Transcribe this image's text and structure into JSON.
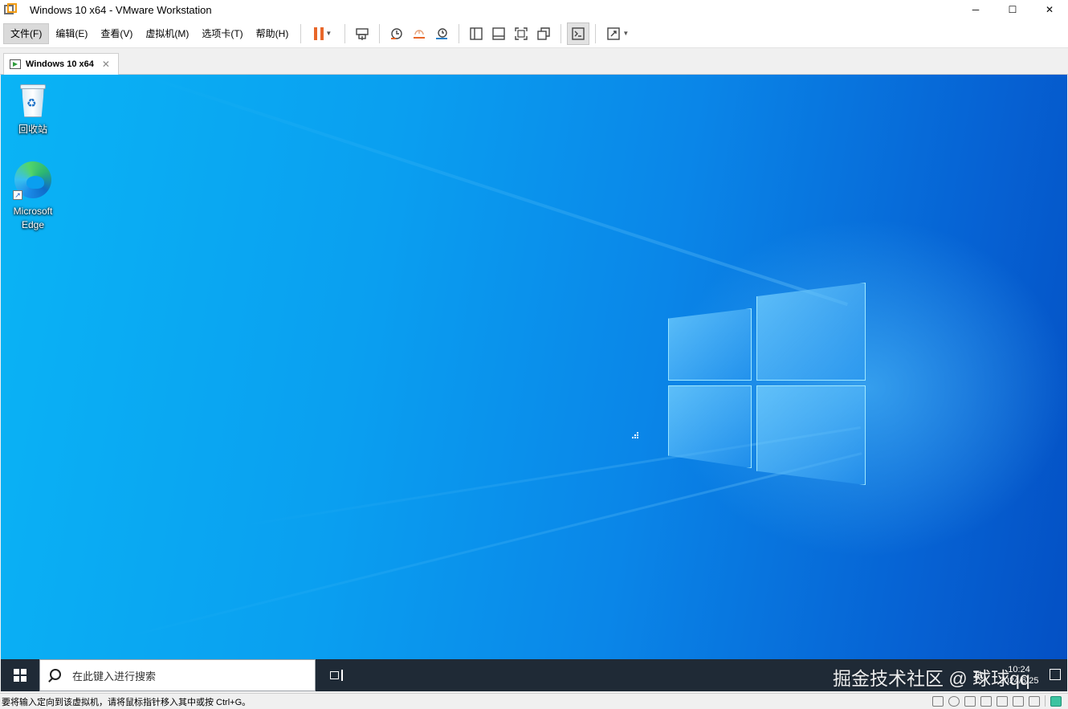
{
  "window": {
    "title": "Windows 10 x64 - VMware Workstation",
    "minimize": "─",
    "maximize": "☐",
    "close": "✕"
  },
  "menu": {
    "file": "文件(F)",
    "edit": "编辑(E)",
    "view": "查看(V)",
    "vm": "虚拟机(M)",
    "tabs": "选项卡(T)",
    "help": "帮助(H)"
  },
  "toolbar": {
    "icons": [
      "pause-icon",
      "send-ctrl-alt-del-icon",
      "snapshot-icon",
      "revert-snapshot-icon",
      "snapshot-manager-icon",
      "show-library-icon",
      "thumbnail-bar-icon",
      "full-screen-icon",
      "unity-icon",
      "console-icon",
      "stretch-icon"
    ],
    "accent": "#e8672a"
  },
  "tab": {
    "label": "Windows 10 x64",
    "close": "✕"
  },
  "desktop": {
    "icons": [
      {
        "label": "回收站"
      },
      {
        "label": "Microsoft Edge"
      }
    ],
    "wallpaper_colors": [
      "#0ab4f5",
      "#0663d4",
      "#0450c4"
    ]
  },
  "taskbar": {
    "search_placeholder": "在此键入进行搜索",
    "ime": "英",
    "time": "10:24",
    "date": "2024/6/25",
    "background": "#1f2a36"
  },
  "watermark": "掘金技术社区 @ 球球qq",
  "statusbar": {
    "message": "要将输入定向到该虚拟机，请将鼠标指针移入其中或按 Ctrl+G。"
  }
}
